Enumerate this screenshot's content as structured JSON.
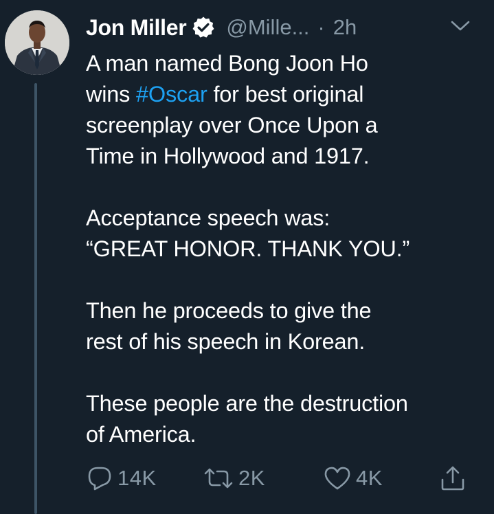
{
  "tweet": {
    "author_name": "Jon Miller",
    "handle": "@Mille...",
    "separator": "·",
    "timestamp": "2h",
    "body": {
      "line1": "A man named Bong Joon Ho",
      "line2_before": "wins ",
      "hashtag": "#Oscar",
      "line2_after": " for best original",
      "line3": "screenplay over Once Upon a",
      "line4": "Time in Hollywood and 1917.",
      "line5": "Acceptance speech was:",
      "line6": "“GREAT HONOR. THANK YOU.”",
      "line7": "Then he proceeds to give the",
      "line8": "rest of his speech in Korean.",
      "line9": "These people are the destruction",
      "line10": "of America."
    },
    "actions": {
      "replies": "14K",
      "retweets": "2K",
      "likes": "4K"
    }
  },
  "colors": {
    "background": "#15202b",
    "text": "#ffffff",
    "secondary": "#8899a6",
    "hashtag": "#1da1f2",
    "thread_line": "#3d5466"
  },
  "icons": {
    "verified": "verified-badge-icon",
    "caret": "chevron-down-icon",
    "reply": "reply-icon",
    "retweet": "retweet-icon",
    "like": "heart-icon",
    "share": "share-icon"
  }
}
